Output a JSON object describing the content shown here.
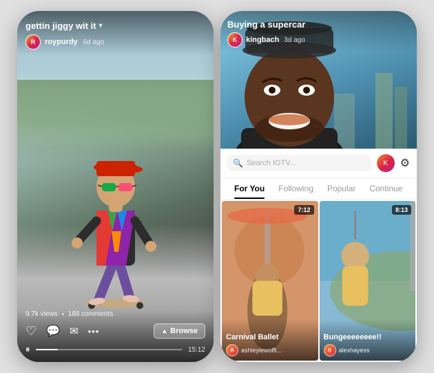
{
  "left_phone": {
    "video_title": "gettin jiggy wit it",
    "username": "roypurdy",
    "time_ago": "6d ago",
    "stats_views": "9.7k views",
    "stats_comments": "188 comments",
    "browse_label": "Browse",
    "duration": "15:12",
    "avatar_initials": "R"
  },
  "right_phone": {
    "video_title": "Buying a supercar",
    "username": "kingbach",
    "time_ago": "3d ago",
    "search_placeholder": "Search IGTV...",
    "avatar_initials": "K",
    "tabs": [
      {
        "label": "For You",
        "active": true
      },
      {
        "label": "Following",
        "active": false
      },
      {
        "label": "Popular",
        "active": false
      },
      {
        "label": "Continue",
        "active": false
      }
    ],
    "grid_items": [
      {
        "title": "Carnival Ballet",
        "username": "ashleylewoffi...",
        "duration": "7:12",
        "avatar_initials": "A"
      },
      {
        "title": "Bungeeeeeeee!!",
        "username": "alexhayess",
        "duration": "8:13",
        "avatar_initials": "X"
      }
    ]
  },
  "icons": {
    "heart": "♡",
    "comment": "💬",
    "send": "✈",
    "more": "•••",
    "pause": "⏸",
    "chevron_up": "▲",
    "chevron_down": "▾",
    "search": "🔍",
    "gear": "⚙"
  }
}
